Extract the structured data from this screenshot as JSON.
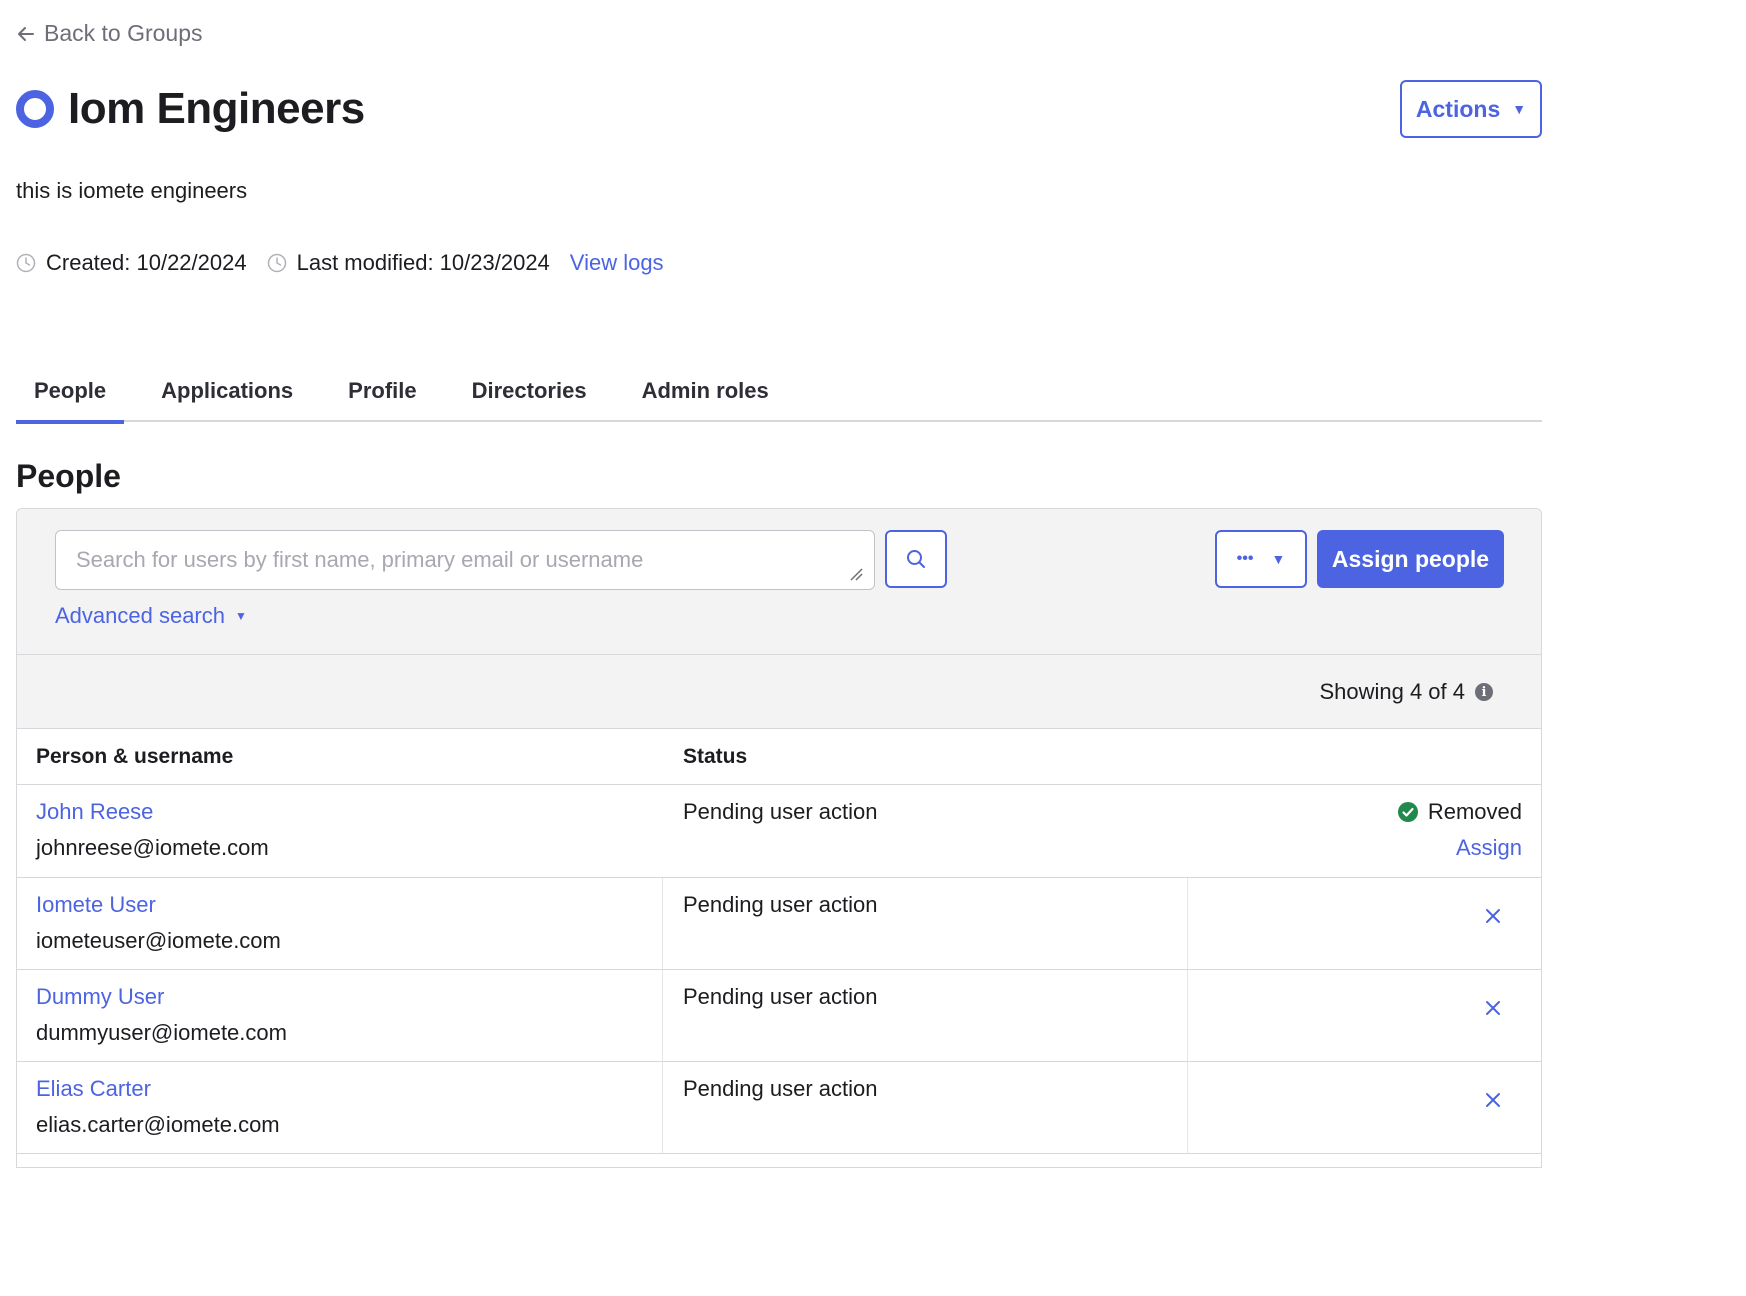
{
  "nav": {
    "back_label": "Back to Groups"
  },
  "group": {
    "title": "Iom Engineers",
    "description": "this is iomete engineers",
    "created": "Created: 10/22/2024",
    "last_modified": "Last modified: 10/23/2024",
    "view_logs": "View logs",
    "actions_label": "Actions"
  },
  "tabs": [
    {
      "label": "People",
      "active": true
    },
    {
      "label": "Applications"
    },
    {
      "label": "Profile"
    },
    {
      "label": "Directories"
    },
    {
      "label": "Admin roles"
    }
  ],
  "section": {
    "title": "People"
  },
  "toolbar": {
    "search_placeholder": "Search for users by first name, primary email or username",
    "advanced_search": "Advanced search",
    "more_label": "•••",
    "assign_label": "Assign people"
  },
  "count": {
    "text": "Showing 4 of 4"
  },
  "table": {
    "headers": {
      "person": "Person & username",
      "status": "Status"
    },
    "rows": [
      {
        "name": "John Reese",
        "email": "johnreese@iomete.com",
        "status": "Pending user action",
        "removed_label": "Removed",
        "assign_label": "Assign"
      },
      {
        "name": "Iomete User",
        "email": "iometeuser@iomete.com",
        "status": "Pending user action"
      },
      {
        "name": "Dummy User",
        "email": "dummyuser@iomete.com",
        "status": "Pending user action"
      },
      {
        "name": "Elias Carter",
        "email": "elias.carter@iomete.com",
        "status": "Pending user action"
      }
    ]
  },
  "colors": {
    "accent": "#4c64e2",
    "success": "#1f8a4c",
    "text": "#1d1d21",
    "muted": "#6e6e78"
  }
}
